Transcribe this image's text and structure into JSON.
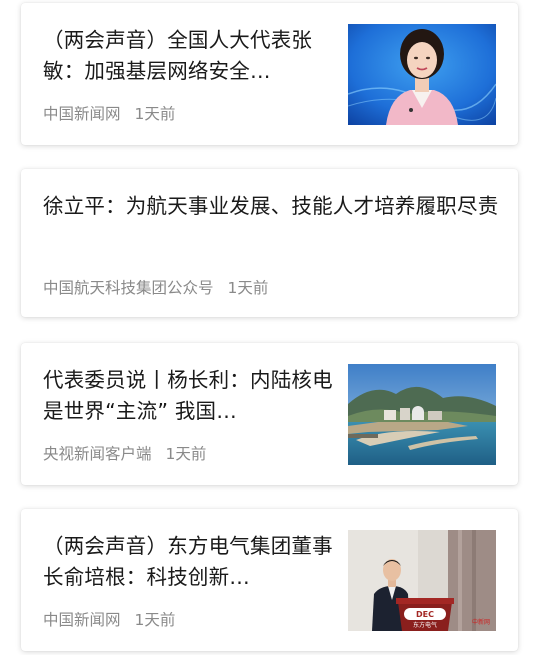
{
  "feed": {
    "items": [
      {
        "title": "（两会声音）全国人大代表张敏：加强基层网络安全…",
        "source": "中国新闻网",
        "time": "1天前",
        "thumbnail": "woman-speaker-photo"
      },
      {
        "title": "徐立平：为航天事业发展、技能人才培养履职尽责",
        "source": "中国航天科技集团公众号",
        "time": "1天前",
        "thumbnail": ""
      },
      {
        "title": "代表委员说丨杨长利：内陆核电是世界“主流” 我国…",
        "source": "央视新闻客户端",
        "time": "1天前",
        "thumbnail": "coastal-nuclear-plant-photo"
      },
      {
        "title": "（两会声音）东方电气集团董事长俞培根：科技创新…",
        "source": "中国新闻网",
        "time": "1天前",
        "thumbnail": "man-at-podium-photo",
        "thumbnail_text": {
          "logo": "DEC",
          "podium": "东方电气",
          "watermark": "中新网"
        }
      }
    ]
  },
  "colors": {
    "title": "#1a1a1a",
    "meta": "#8a8a8a",
    "card_bg": "#ffffff"
  }
}
